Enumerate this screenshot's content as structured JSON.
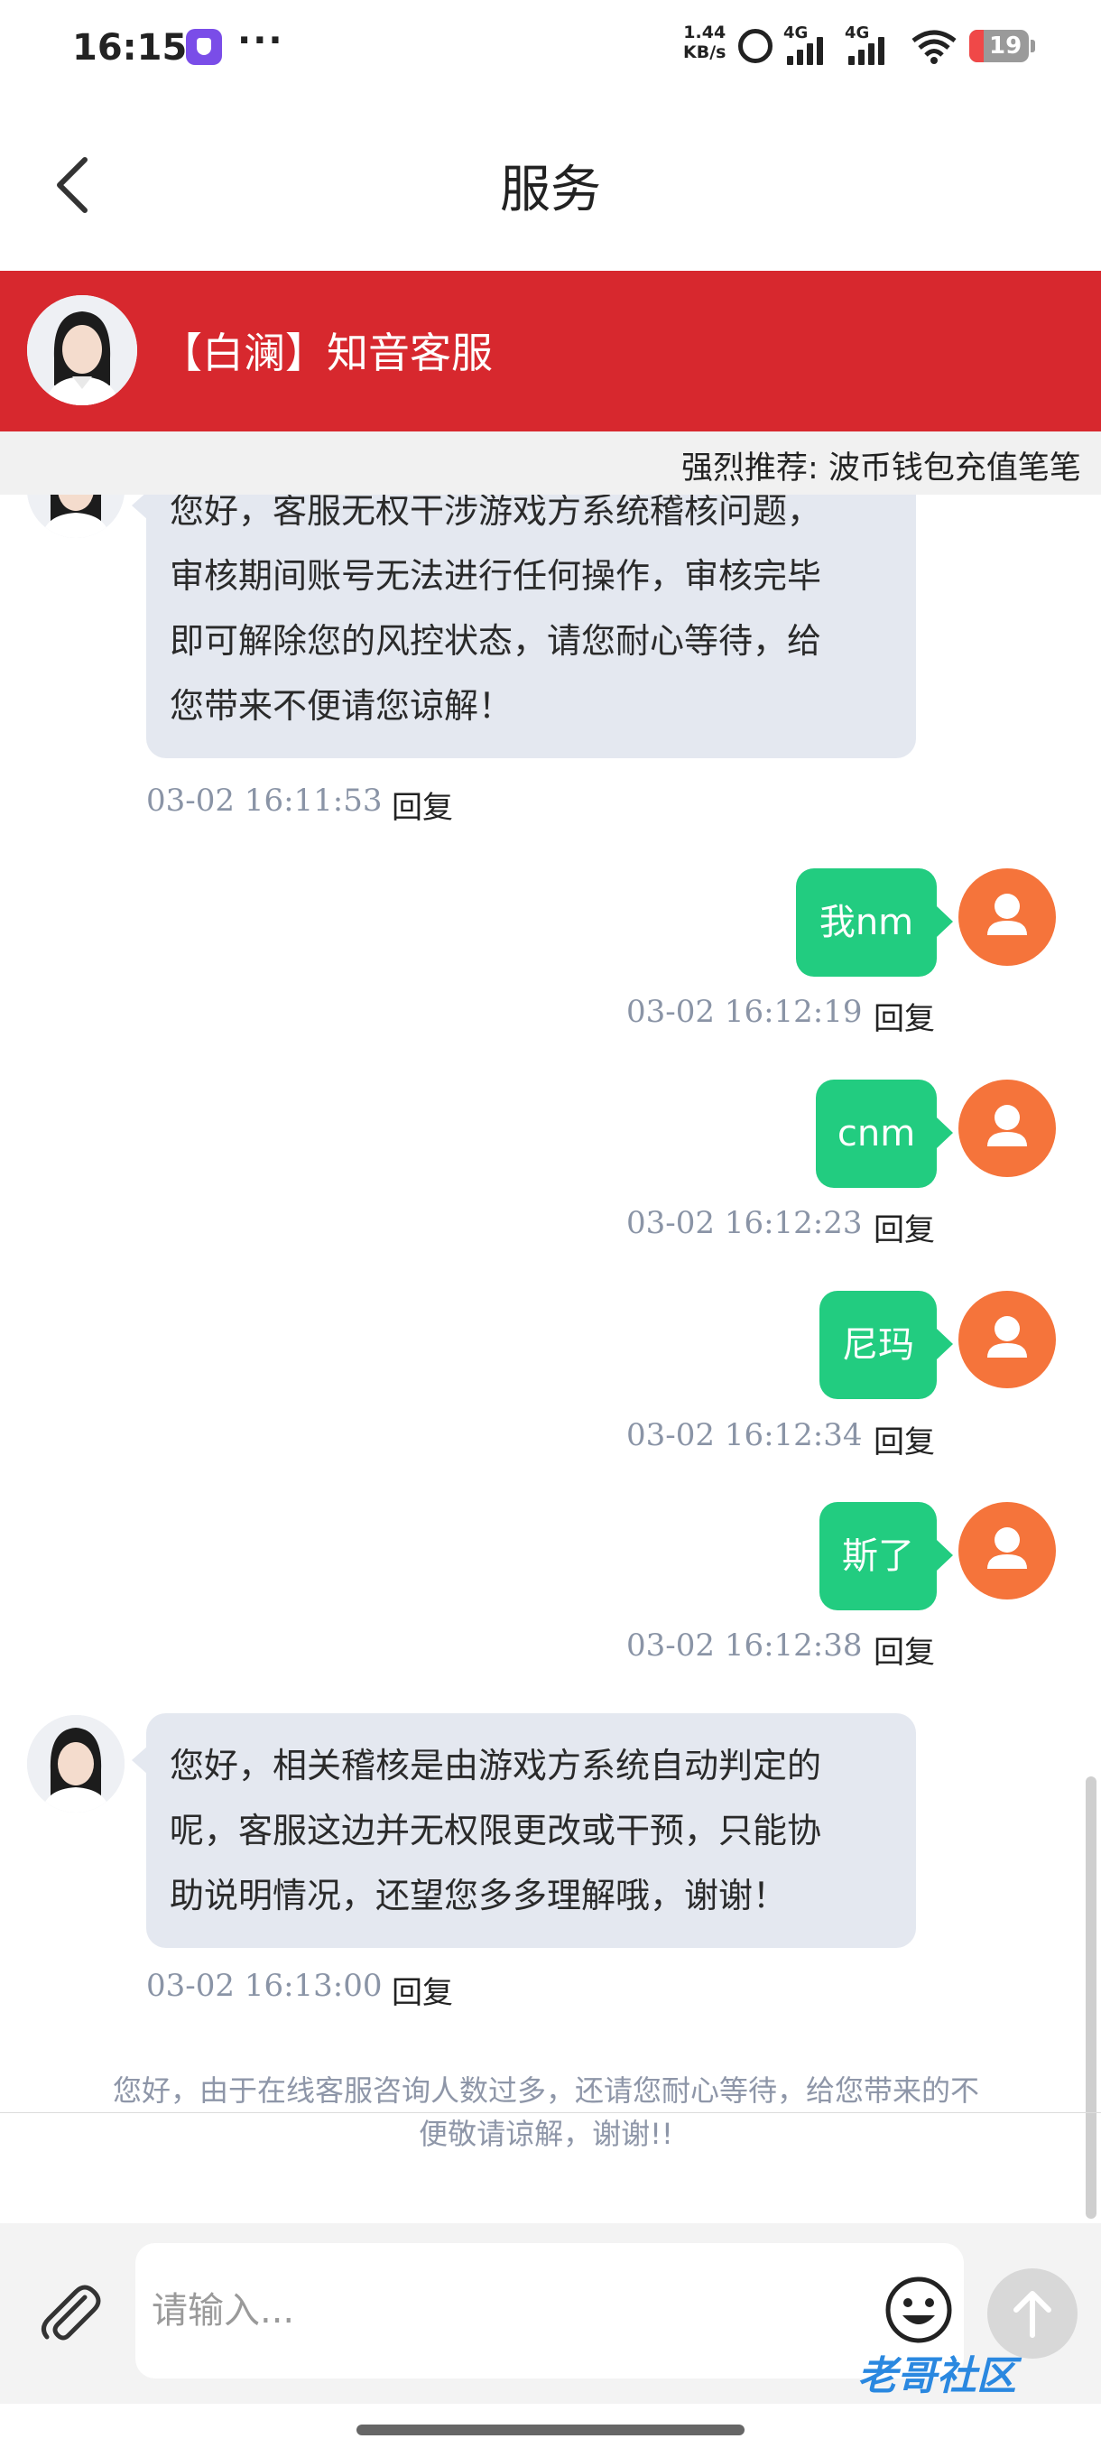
{
  "status_bar": {
    "time": "16:15",
    "speed_value": "1.44",
    "speed_unit": "KB/s",
    "net1": "4G",
    "net2": "4G",
    "battery": "19"
  },
  "header": {
    "back_icon": "chevron-left-icon",
    "title": "服务"
  },
  "agent_banner": {
    "name": "【白澜】知音客服"
  },
  "marquee": {
    "text": "强烈推荐: 波币钱包充值笔笔"
  },
  "messages": [
    {
      "side": "left",
      "lines": [
        "您好，客服无权干涉游戏方系统稽核问题，",
        "审核期间账号无法进行任何操作，审核完毕",
        "即可解除您的风控状态，请您耐心等待，给",
        "您带来不便请您谅解！"
      ],
      "time": "03-02 16:11:53",
      "reply": "回复"
    },
    {
      "side": "right",
      "text": "我nm",
      "time": "03-02 16:12:19",
      "reply": "回复"
    },
    {
      "side": "right",
      "text": "cnm",
      "time": "03-02 16:12:23",
      "reply": "回复"
    },
    {
      "side": "right",
      "text": "尼玛",
      "time": "03-02 16:12:34",
      "reply": "回复"
    },
    {
      "side": "right",
      "text": "斯了",
      "time": "03-02 16:12:38",
      "reply": "回复"
    },
    {
      "side": "left",
      "lines": [
        "您好，相关稽核是由游戏方系统自动判定的",
        "呢，客服这边并无权限更改或干预，只能协",
        "助说明情况，还望您多多理解哦，谢谢！"
      ],
      "time": "03-02 16:13:00",
      "reply": "回复"
    }
  ],
  "notice": {
    "line1": "您好，由于在线客服咨询人数过多，还请您耐心等待，给您带来的不",
    "line2": "便敬请谅解，谢谢!!"
  },
  "input_bar": {
    "placeholder": "请输入...",
    "attach_icon": "paperclip-icon",
    "emoji_icon": "smiley-icon",
    "send_icon": "arrow-up-icon"
  },
  "watermark": "老哥社区",
  "colors": {
    "banner": "#d7282e",
    "user_bubble": "#22cc80",
    "agent_bubble": "#e4e8f0",
    "user_avatar": "#f5743b"
  }
}
